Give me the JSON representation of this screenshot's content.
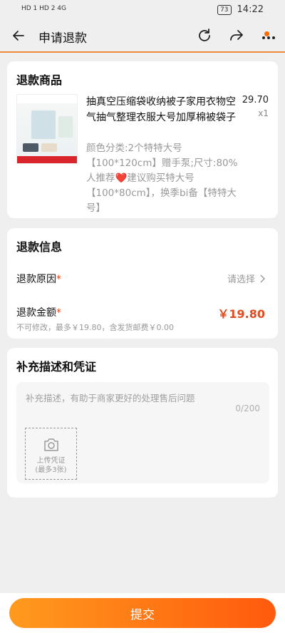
{
  "status_bar": {
    "left_text": "HD 1 HD 2 4G",
    "battery": "73",
    "time": "14:22"
  },
  "header": {
    "title": "申请退款"
  },
  "product_section": {
    "title": "退款商品",
    "product": {
      "name": "抽真空压缩袋收纳被子家用衣物空气抽气整理衣服大号加厚棉被袋子",
      "spec": "颜色分类:2个特特大号【100*120cm】赠手泵;尺寸:80%人推荐❤️建议购买特大号【100*80cm】，换季bi备【特特大号】",
      "price": "29.70",
      "quantity": "x1"
    }
  },
  "refund_info": {
    "title": "退款信息",
    "reason_label": "退款原因",
    "required_mark": "*",
    "reason_value": "请选择",
    "amount_label": "退款金额",
    "amount_value": "￥19.80",
    "amount_note": "不可修改，最多￥19.80，含发货邮费￥0.00"
  },
  "description": {
    "title": "补充描述和凭证",
    "placeholder": "补充描述，有助于商家更好的处理售后问题",
    "counter": "0/200",
    "upload_label": "上传凭证",
    "upload_hint": "(最多3张)"
  },
  "footer": {
    "submit_label": "提交"
  },
  "colors": {
    "accent": "#ff6a00",
    "price_red": "#e14b1f",
    "button_gradient_start": "#ff9a1e",
    "button_gradient_end": "#ff5a0d"
  },
  "icons": [
    "back-arrow-icon",
    "refresh-icon",
    "share-icon",
    "more-icon",
    "chevron-right-icon",
    "camera-icon"
  ]
}
